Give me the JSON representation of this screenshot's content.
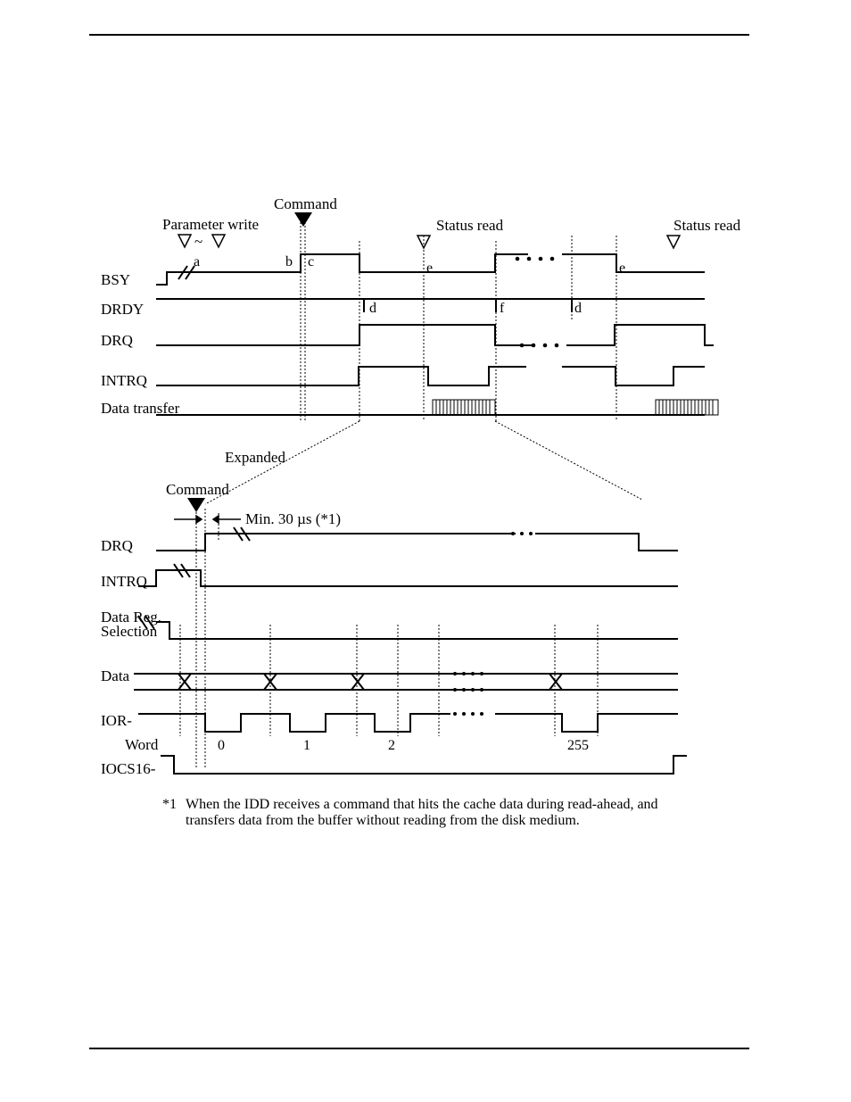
{
  "labels": {
    "command_top": "Command",
    "parameter_write": "Parameter write",
    "status_read1": "Status read",
    "status_read2": "Status read",
    "a": "a",
    "b": "b",
    "c": "c",
    "d": "d",
    "e": "e",
    "f": "f",
    "bsy": "BSY",
    "drdy": "DRDY",
    "drq": "DRQ",
    "intrq": "INTRQ",
    "data_transfer": "Data transfer",
    "expanded": "Expanded",
    "command_exp": "Command",
    "min30": "Min. 30 µs (*1)",
    "drq_exp": "DRQ",
    "intrq_exp": "INTRQ",
    "data_reg_sel1": "Data Reg.",
    "data_reg_sel2": "Selection",
    "data_label": "Data",
    "ior": "IOR-",
    "word": "Word",
    "w0": "0",
    "w1": "1",
    "w2": "2",
    "w255": "255",
    "iocs16": "IOCS16-",
    "star1": "*1",
    "footnote": "When the IDD receives a command that hits the cache data during read-ahead, and",
    "footnote2": "transfers data from the buffer without reading from the disk medium."
  }
}
